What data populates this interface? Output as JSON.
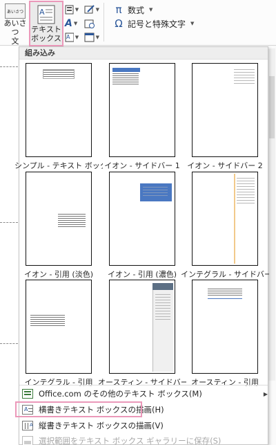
{
  "ribbon": {
    "aisatsu_icon_text": "あいさつ",
    "aisatsu_label": "あいさつ\n文",
    "textbox_label": "テキスト\nボックス",
    "symbols": [
      {
        "glyph": "π",
        "label": "数式"
      },
      {
        "glyph": "Ω",
        "label": "記号と特殊文字"
      }
    ]
  },
  "gallery": {
    "header": "組み込み",
    "items": [
      {
        "label": "シンプル - テキスト ボックス"
      },
      {
        "label": "イオン - サイドバー 1"
      },
      {
        "label": "イオン - サイドバー 2"
      },
      {
        "label": "イオン - 引用 (淡色)"
      },
      {
        "label": "イオン - 引用 (濃色)"
      },
      {
        "label": "インテグラル - サイドバー"
      },
      {
        "label": "インテグラル - 引用"
      },
      {
        "label": "オースティン - サイドバー"
      },
      {
        "label": "オースティン - 引用"
      }
    ]
  },
  "menu": {
    "more_textboxes": "Office.com のその他のテキスト ボックス(M)",
    "draw_horizontal": "横書きテキスト ボックスの描画(H)",
    "draw_vertical": "縦書きテキスト ボックスの描画(V)",
    "save_selection": "選択範囲をテキスト ボックス ギャラリーに保存(S)"
  },
  "colors": {
    "highlight_pink": "#eb98b9",
    "ion_blue": "#4a78c2",
    "austin_slate": "#5c6f84"
  }
}
